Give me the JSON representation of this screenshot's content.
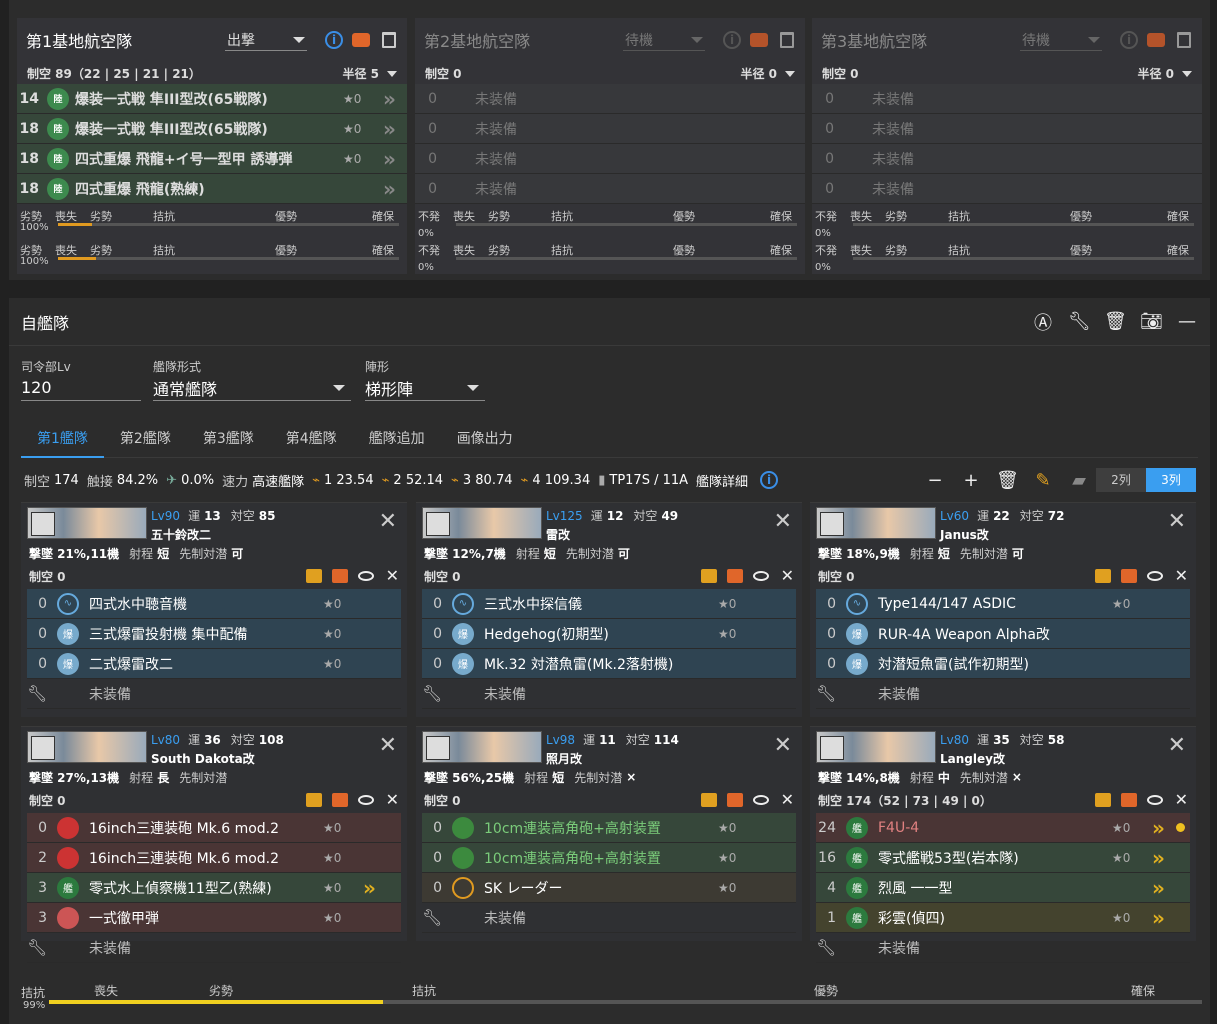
{
  "base_air": [
    {
      "title": "第1基地航空隊",
      "mode": "出撃",
      "air_power": "制空 89（22 | 25 | 21 | 21）",
      "radius": "半径 5",
      "slots": [
        {
          "count": "14",
          "name": "爆装一式戦 隼III型改(65戦隊)",
          "star": "★0"
        },
        {
          "count": "18",
          "name": "爆装一式戦 隼III型改(65戦隊)",
          "star": "★0"
        },
        {
          "count": "18",
          "name": "四式重爆 飛龍+イ号一型甲 誘導弾",
          "star": "★0"
        },
        {
          "count": "18",
          "name": "四式重爆 飛龍(熟練)",
          "star": ""
        }
      ],
      "status": [
        {
          "left": "劣勢",
          "pct": "100%",
          "fill": 0.1
        },
        {
          "left": "劣勢",
          "pct": "100%",
          "fill": 0.11
        }
      ]
    },
    {
      "title": "第2基地航空隊",
      "mode": "待機",
      "air_power": "制空 0",
      "radius": "半径 0",
      "slots": [
        {
          "count": "0",
          "name": "未装備"
        },
        {
          "count": "0",
          "name": "未装備"
        },
        {
          "count": "0",
          "name": "未装備"
        },
        {
          "count": "0",
          "name": "未装備"
        }
      ],
      "status": [
        {
          "left": "不発",
          "pct": "0%",
          "fill": 0
        },
        {
          "left": "不発",
          "pct": "0%",
          "fill": 0
        }
      ]
    },
    {
      "title": "第3基地航空隊",
      "mode": "待機",
      "air_power": "制空 0",
      "radius": "半径 0",
      "slots": [
        {
          "count": "0",
          "name": "未装備"
        },
        {
          "count": "0",
          "name": "未装備"
        },
        {
          "count": "0",
          "name": "未装備"
        },
        {
          "count": "0",
          "name": "未装備"
        }
      ],
      "status": [
        {
          "left": "不発",
          "pct": "0%",
          "fill": 0
        },
        {
          "left": "不発",
          "pct": "0%",
          "fill": 0
        }
      ]
    }
  ],
  "scale_labels": {
    "a": "喪失",
    "b": "劣勢",
    "c": "拮抗",
    "d": "優勢",
    "e": "確保"
  },
  "fleet": {
    "title": "自艦隊",
    "hq_label": "司令部Lv",
    "hq_value": "120",
    "type_label": "艦隊形式",
    "type_value": "通常艦隊",
    "formation_label": "陣形",
    "formation_value": "梯形陣",
    "tabs": [
      "第1艦隊",
      "第2艦隊",
      "第3艦隊",
      "第4艦隊",
      "艦隊追加",
      "画像出力"
    ],
    "stats": {
      "air_label": "制空",
      "air": "174",
      "contact_label": "触接",
      "contact": "84.2%",
      "aa": "0.0%",
      "speed_label": "速力",
      "speed": "高速艦隊",
      "los1": "1 23.54",
      "los2": "2 52.14",
      "los3": "3 80.74",
      "los4": "4 109.34",
      "tp": "TP17S / 11A",
      "detail": "艦隊詳細"
    },
    "cols": [
      "2列",
      "3列"
    ],
    "bottom": {
      "pct": "99%",
      "fill": 0.29,
      "a": "拮抗",
      "b": "喪失",
      "c": "劣勢",
      "d": "拮抗",
      "e": "優勢",
      "f": "確保"
    }
  },
  "ships": [
    {
      "lv": "Lv90",
      "luck": "13",
      "aa": "85",
      "name": "五十鈴改二",
      "line2": "撃墜 21%,11機",
      "range": "短",
      "asw": "可",
      "air": "制空 0",
      "equips": [
        {
          "n": "0",
          "name": "四式水中聴音機",
          "star": "★0",
          "type": "sonar",
          "tone": "blue"
        },
        {
          "n": "0",
          "name": "三式爆雷投射機 集中配備",
          "star": "★0",
          "type": "dc",
          "tone": "blue"
        },
        {
          "n": "0",
          "name": "二式爆雷改二",
          "star": "★0",
          "type": "dc",
          "tone": "blue"
        }
      ],
      "ex": "未装備"
    },
    {
      "lv": "Lv125",
      "luck": "12",
      "aa": "49",
      "name": "雷改",
      "line2": "撃墜 12%,7機",
      "range": "短",
      "asw": "可",
      "air": "制空 0",
      "equips": [
        {
          "n": "0",
          "name": "三式水中探信儀",
          "star": "★0",
          "type": "sonar",
          "tone": "blue"
        },
        {
          "n": "0",
          "name": "Hedgehog(初期型)",
          "star": "★0",
          "type": "dc",
          "tone": "blue"
        },
        {
          "n": "0",
          "name": "Mk.32 対潜魚雷(Mk.2落射機)",
          "star": "",
          "type": "dc",
          "tone": "blue"
        }
      ],
      "ex": "未装備"
    },
    {
      "lv": "Lv60",
      "luck": "22",
      "aa": "72",
      "name": "Janus改",
      "line2": "撃墜 18%,9機",
      "range": "短",
      "asw": "可",
      "air": "制空 0",
      "equips": [
        {
          "n": "0",
          "name": "Type144/147 ASDIC",
          "star": "★0",
          "type": "sonar",
          "tone": "blue"
        },
        {
          "n": "0",
          "name": "RUR-4A Weapon Alpha改",
          "star": "",
          "type": "dc",
          "tone": "blue"
        },
        {
          "n": "0",
          "name": "対潜短魚雷(試作初期型)",
          "star": "",
          "type": "dc",
          "tone": "blue"
        }
      ],
      "ex": "未装備"
    },
    {
      "lv": "Lv80",
      "luck": "36",
      "aa": "108",
      "name": "South Dakota改",
      "line2": "撃墜 27%,13機",
      "range": "長",
      "asw": "",
      "air": "制空 0",
      "equips": [
        {
          "n": "0",
          "name": "16inch三連装砲 Mk.6 mod.2",
          "star": "★0",
          "type": "gun",
          "tone": "red"
        },
        {
          "n": "2",
          "name": "16inch三連装砲 Mk.6 mod.2",
          "star": "★0",
          "type": "gun",
          "tone": "red"
        },
        {
          "n": "3",
          "name": "零式水上偵察機11型乙(熟練)",
          "star": "★0",
          "type": "plane",
          "tone": "green",
          "chev": "》"
        },
        {
          "n": "3",
          "name": "一式徹甲弾",
          "star": "★0",
          "type": "ap",
          "tone": "red"
        }
      ],
      "ex": "未装備"
    },
    {
      "lv": "Lv98",
      "luck": "11",
      "aa": "114",
      "name": "照月改",
      "line2": "撃墜 56%,25機",
      "range": "短",
      "asw": "×",
      "air": "制空 0",
      "equips": [
        {
          "n": "0",
          "name": "10cm連装高角砲+高射装置",
          "star": "★0",
          "type": "hag",
          "tone": "green",
          "txt": "g"
        },
        {
          "n": "0",
          "name": "10cm連装高角砲+高射装置",
          "star": "★0",
          "type": "hag",
          "tone": "green",
          "txt": "g"
        },
        {
          "n": "0",
          "name": "SK レーダー",
          "star": "★0",
          "type": "rad",
          "tone": "brown"
        }
      ],
      "ex": "未装備"
    },
    {
      "lv": "Lv80",
      "luck": "35",
      "aa": "58",
      "name": "Langley改",
      "line2": "撃墜 14%,8機",
      "range": "中",
      "asw": "×",
      "air": "制空 174（52 | 73 | 49 | 0）",
      "equips": [
        {
          "n": "24",
          "name": "F4U-4",
          "star": "★0",
          "type": "plane",
          "tone": "red",
          "txt": "r",
          "chev": "》",
          "dot": true
        },
        {
          "n": "16",
          "name": "零式艦戦53型(岩本隊)",
          "star": "★0",
          "type": "plane",
          "tone": "green",
          "chev": "》"
        },
        {
          "n": "4",
          "name": "烈風 一一型",
          "star": "",
          "type": "plane",
          "tone": "green",
          "chev": "》"
        },
        {
          "n": "1",
          "name": "彩雲(偵四)",
          "star": "★0",
          "type": "plane",
          "tone": "gold",
          "chev": "》"
        }
      ],
      "ex": "未装備"
    }
  ],
  "labels": {
    "luck": "運",
    "aa": "対空",
    "range": "射程",
    "asw": "先制対潜"
  }
}
